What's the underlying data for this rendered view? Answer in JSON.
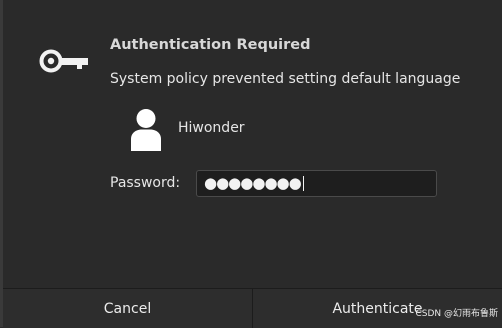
{
  "dialog": {
    "icon": "key-icon",
    "title": "Authentication Required",
    "message": "System policy prevented setting default language",
    "user": {
      "avatar_icon": "user-icon",
      "name": "Hiwonder"
    },
    "password": {
      "label": "Password:",
      "masked_value": "●●●●●●●●"
    },
    "buttons": {
      "cancel": "Cancel",
      "authenticate": "Authenticate"
    }
  },
  "watermark": "CSDN @幻雨布鲁斯"
}
